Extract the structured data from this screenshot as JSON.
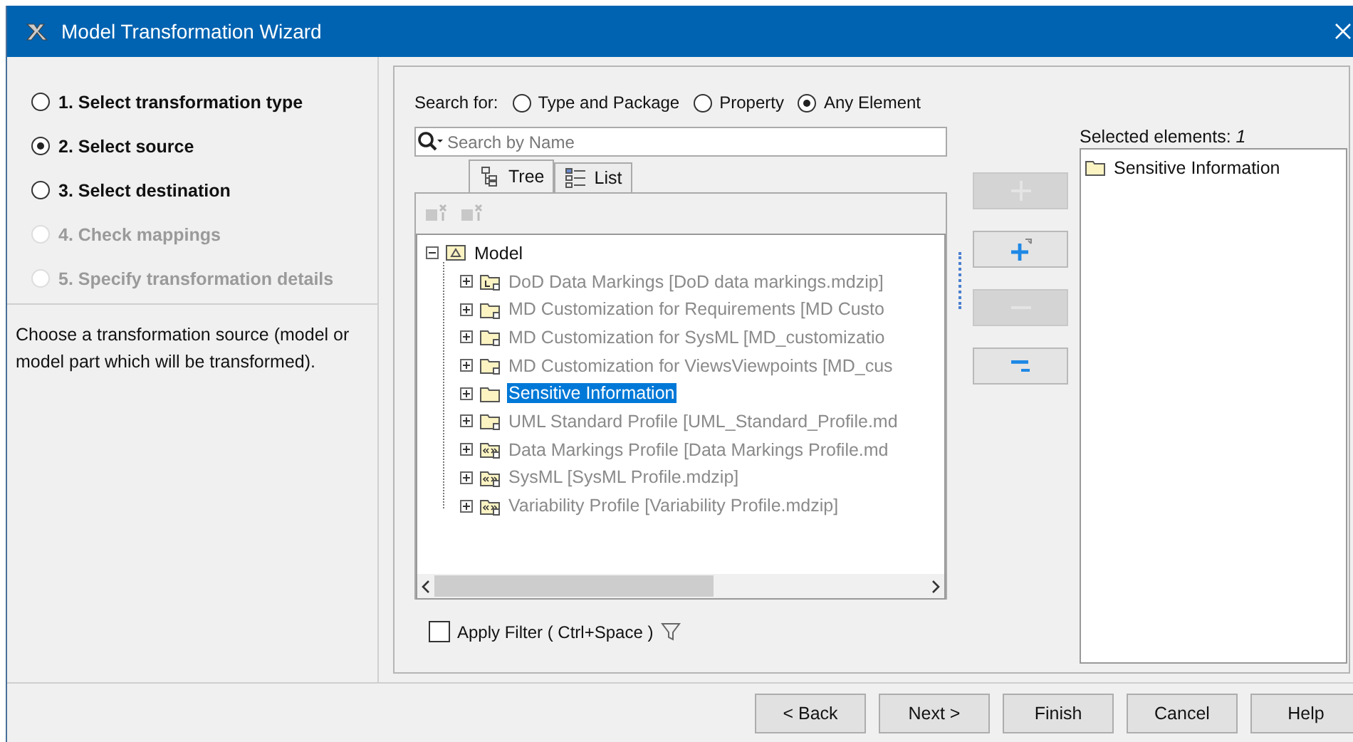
{
  "window": {
    "title": "Model Transformation Wizard"
  },
  "steps": [
    {
      "label": "1. Select transformation type",
      "selected": false,
      "disabled": false
    },
    {
      "label": "2. Select source",
      "selected": true,
      "disabled": false
    },
    {
      "label": "3. Select destination",
      "selected": false,
      "disabled": false
    },
    {
      "label": "4. Check mappings",
      "selected": false,
      "disabled": true
    },
    {
      "label": "5. Specify transformation details",
      "selected": false,
      "disabled": true
    }
  ],
  "description": "Choose a transformation source (model or model part which will be transformed).",
  "search_for": {
    "label": "Search for:",
    "options": [
      {
        "label": "Type and Package",
        "selected": false
      },
      {
        "label": "Property",
        "selected": false
      },
      {
        "label": "Any Element",
        "selected": true
      }
    ]
  },
  "search": {
    "placeholder": "Search by Name"
  },
  "view_tabs": [
    {
      "label": "Tree",
      "selected": true
    },
    {
      "label": "List",
      "selected": false
    }
  ],
  "tree": [
    {
      "label": "Model",
      "kind": "model",
      "expanded": true,
      "selected": false,
      "disabled": false,
      "children": [
        {
          "label": "DoD Data Markings [DoD data markings.mdzip]",
          "kind": "library",
          "expanded": false,
          "selected": false,
          "disabled": true
        },
        {
          "label": "MD Customization for Requirements [MD Custo",
          "kind": "shared",
          "expanded": false,
          "selected": false,
          "disabled": true
        },
        {
          "label": "MD Customization for SysML [MD_customizatio",
          "kind": "shared",
          "expanded": false,
          "selected": false,
          "disabled": true
        },
        {
          "label": "MD Customization for ViewsViewpoints [MD_cus",
          "kind": "shared",
          "expanded": false,
          "selected": false,
          "disabled": true
        },
        {
          "label": "Sensitive Information",
          "kind": "package",
          "expanded": false,
          "selected": true,
          "disabled": false
        },
        {
          "label": "UML Standard Profile [UML_Standard_Profile.md",
          "kind": "shared",
          "expanded": false,
          "selected": false,
          "disabled": true
        },
        {
          "label": "Data Markings Profile [Data Markings Profile.md",
          "kind": "profile",
          "expanded": false,
          "selected": false,
          "disabled": true
        },
        {
          "label": "SysML [SysML Profile.mdzip]",
          "kind": "profile",
          "expanded": false,
          "selected": false,
          "disabled": true
        },
        {
          "label": "Variability Profile [Variability Profile.mdzip]",
          "kind": "profile",
          "expanded": false,
          "selected": false,
          "disabled": true
        }
      ]
    }
  ],
  "move_buttons": [
    {
      "kind": "add",
      "disabled": true
    },
    {
      "kind": "add-recursive",
      "disabled": false
    },
    {
      "kind": "remove",
      "disabled": true
    },
    {
      "kind": "remove-all",
      "disabled": false
    }
  ],
  "selected_elements": {
    "label": "Selected elements: *1*",
    "items": [
      {
        "label": "Sensitive Information"
      }
    ]
  },
  "filter": {
    "label": "Apply Filter ( Ctrl+Space )",
    "checked": false
  },
  "buttons": [
    {
      "label": "< Back"
    },
    {
      "label": "Next >"
    },
    {
      "label": "Finish"
    },
    {
      "label": "Cancel"
    },
    {
      "label": "Help"
    }
  ]
}
